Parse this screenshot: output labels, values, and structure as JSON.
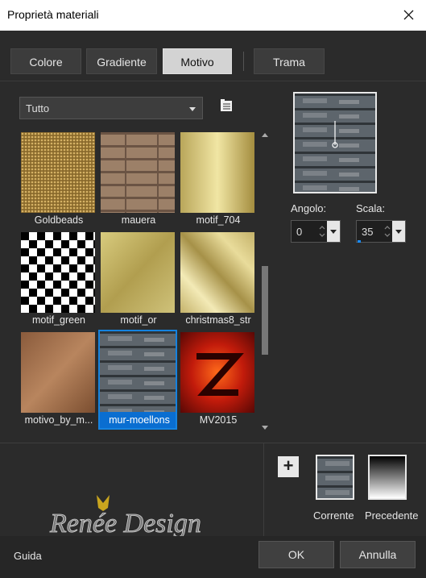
{
  "window": {
    "title": "Proprietà materiali"
  },
  "tabs": [
    {
      "label": "Colore",
      "active": false
    },
    {
      "label": "Gradiente",
      "active": false
    },
    {
      "label": "Motivo",
      "active": true
    },
    {
      "label": "Trama",
      "active": false
    }
  ],
  "category": {
    "value": "Tutto"
  },
  "patterns": [
    {
      "label": "Goldbeads",
      "selected": false
    },
    {
      "label": "mauera",
      "selected": false
    },
    {
      "label": "motif_704",
      "selected": false
    },
    {
      "label": "motif_green",
      "selected": false
    },
    {
      "label": "motif_or",
      "selected": false
    },
    {
      "label": "christmas8_str",
      "selected": false
    },
    {
      "label": "motivo_by_m...",
      "selected": false
    },
    {
      "label": "mur-moellons",
      "selected": true
    },
    {
      "label": "MV2015",
      "selected": false
    }
  ],
  "angle": {
    "label": "Angolo:",
    "value": "0"
  },
  "scale": {
    "label": "Scala:",
    "value": "35"
  },
  "swatches": {
    "current_label": "Corrente",
    "previous_label": "Precedente"
  },
  "watermark": {
    "text": "Renée Design"
  },
  "footer": {
    "help": "Guida",
    "ok": "OK",
    "cancel": "Annulla"
  },
  "colors": {
    "selection": "#0a6ed1",
    "background": "#2b2b2b"
  }
}
